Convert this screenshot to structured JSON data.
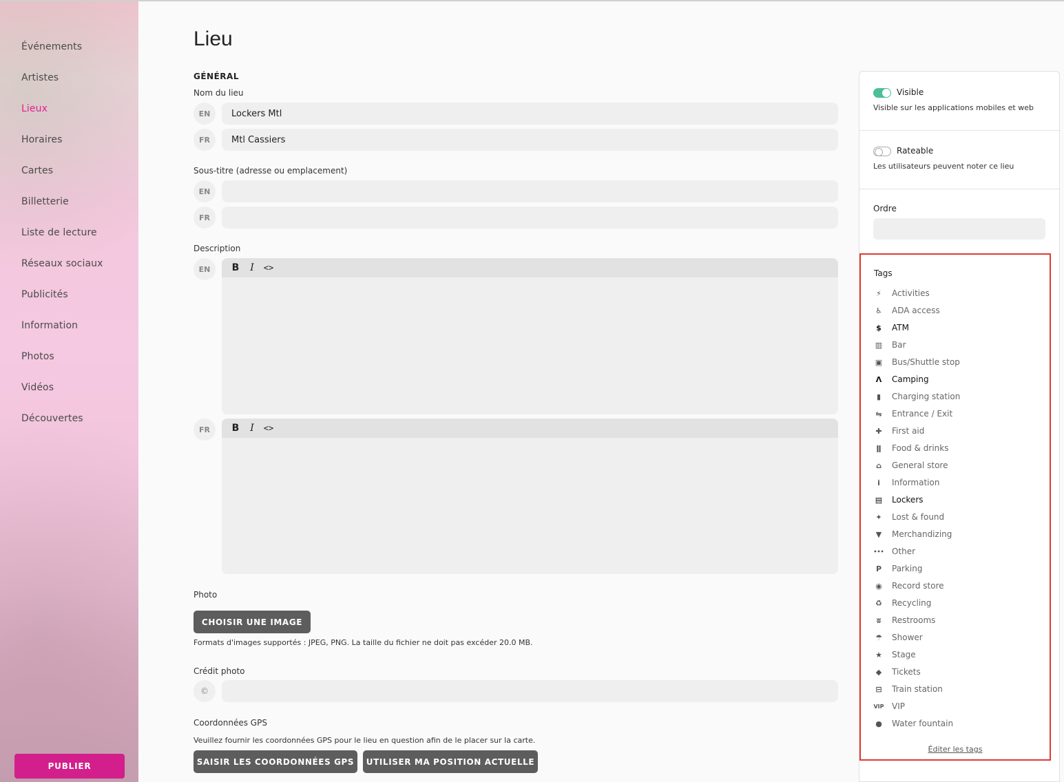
{
  "sidebar": {
    "items": [
      {
        "label": "Événements",
        "active": false
      },
      {
        "label": "Artistes",
        "active": false
      },
      {
        "label": "Lieux",
        "active": true
      },
      {
        "label": "Horaires",
        "active": false
      },
      {
        "label": "Cartes",
        "active": false
      },
      {
        "label": "Billetterie",
        "active": false
      },
      {
        "label": "Liste de lecture",
        "active": false
      },
      {
        "label": "Réseaux sociaux",
        "active": false
      },
      {
        "label": "Publicités",
        "active": false
      },
      {
        "label": "Information",
        "active": false
      },
      {
        "label": "Photos",
        "active": false
      },
      {
        "label": "Vidéos",
        "active": false
      },
      {
        "label": "Découvertes",
        "active": false
      }
    ],
    "publish_label": "PUBLIER",
    "accent_color": "#e0208f"
  },
  "main": {
    "title": "Lieu",
    "section_general": "GÉNÉRAL",
    "name": {
      "label": "Nom du lieu",
      "en_code": "EN",
      "en_value": "Lockers Mtl",
      "fr_code": "FR",
      "fr_value": "Mtl Cassiers"
    },
    "subtitle": {
      "label": "Sous-titre (adresse ou emplacement)",
      "en_code": "EN",
      "en_value": "",
      "fr_code": "FR",
      "fr_value": ""
    },
    "description": {
      "label": "Description",
      "en_code": "EN",
      "fr_code": "FR",
      "toolbar": {
        "bold": "B",
        "italic": "I",
        "code": "<>"
      }
    },
    "photo": {
      "label": "Photo",
      "button": "CHOISIR UNE IMAGE",
      "hint": "Formats d'images supportés : JPEG, PNG. La taille du fichier ne doit pas excéder 20.0 MB."
    },
    "credit": {
      "label": "Crédit photo",
      "symbol": "©",
      "value": ""
    },
    "gps": {
      "label": "Coordonnées GPS",
      "hint": "Veuillez fournir les coordonnées GPS pour le lieu en question afin de le placer sur la carte.",
      "enter_button": "SAISIR LES COORDONNÉES GPS",
      "current_button": "UTILISER MA POSITION ACTUELLE"
    }
  },
  "panel": {
    "visible": {
      "label": "Visible",
      "desc": "Visible sur les applications mobiles et web",
      "on": true,
      "color": "#4bbf9a"
    },
    "rateable": {
      "label": "Rateable",
      "desc": "Les utilisateurs peuvent noter ce lieu",
      "on": false
    },
    "order": {
      "label": "Ordre",
      "value": ""
    },
    "tags": {
      "title": "Tags",
      "items": [
        {
          "label": "Activities",
          "icon": "activities-icon",
          "glyph": "⚡",
          "selected": false
        },
        {
          "label": "ADA access",
          "icon": "wheelchair-icon",
          "glyph": "♿",
          "selected": false
        },
        {
          "label": "ATM",
          "icon": "dollar-icon",
          "glyph": "$",
          "selected": true
        },
        {
          "label": "Bar",
          "icon": "beer-icon",
          "glyph": "▥",
          "selected": false
        },
        {
          "label": "Bus/Shuttle stop",
          "icon": "bus-icon",
          "glyph": "▣",
          "selected": false
        },
        {
          "label": "Camping",
          "icon": "tent-icon",
          "glyph": "Λ",
          "selected": true
        },
        {
          "label": "Charging station",
          "icon": "battery-icon",
          "glyph": "▮",
          "selected": false
        },
        {
          "label": "Entrance / Exit",
          "icon": "enter-exit-icon",
          "glyph": "⇋",
          "selected": false
        },
        {
          "label": "First aid",
          "icon": "first-aid-icon",
          "glyph": "✚",
          "selected": false
        },
        {
          "label": "Food & drinks",
          "icon": "utensils-icon",
          "glyph": "ǁ",
          "selected": false
        },
        {
          "label": "General store",
          "icon": "store-icon",
          "glyph": "⌂",
          "selected": false
        },
        {
          "label": "Information",
          "icon": "info-icon",
          "glyph": "i",
          "selected": false
        },
        {
          "label": "Lockers",
          "icon": "locker-icon",
          "glyph": "▤",
          "selected": true
        },
        {
          "label": "Lost & found",
          "icon": "lost-found-icon",
          "glyph": "✦",
          "selected": false
        },
        {
          "label": "Merchandizing",
          "icon": "tshirt-icon",
          "glyph": "▼",
          "selected": false
        },
        {
          "label": "Other",
          "icon": "ellipsis-icon",
          "glyph": "•••",
          "selected": false
        },
        {
          "label": "Parking",
          "icon": "parking-icon",
          "glyph": "P",
          "selected": false
        },
        {
          "label": "Record store",
          "icon": "vinyl-icon",
          "glyph": "◉",
          "selected": false
        },
        {
          "label": "Recycling",
          "icon": "recycle-icon",
          "glyph": "♻",
          "selected": false
        },
        {
          "label": "Restrooms",
          "icon": "restroom-icon",
          "glyph": "ʬ",
          "selected": false
        },
        {
          "label": "Shower",
          "icon": "shower-icon",
          "glyph": "☂",
          "selected": false
        },
        {
          "label": "Stage",
          "icon": "star-icon",
          "glyph": "★",
          "selected": false
        },
        {
          "label": "Tickets",
          "icon": "ticket-icon",
          "glyph": "◆",
          "selected": false
        },
        {
          "label": "Train station",
          "icon": "train-icon",
          "glyph": "⊟",
          "selected": false
        },
        {
          "label": "VIP",
          "icon": "vip-icon",
          "glyph": "VIP",
          "selected": false
        },
        {
          "label": "Water fountain",
          "icon": "water-drop-icon",
          "glyph": "●",
          "selected": false
        }
      ],
      "edit_link": "Éditer les tags"
    }
  }
}
